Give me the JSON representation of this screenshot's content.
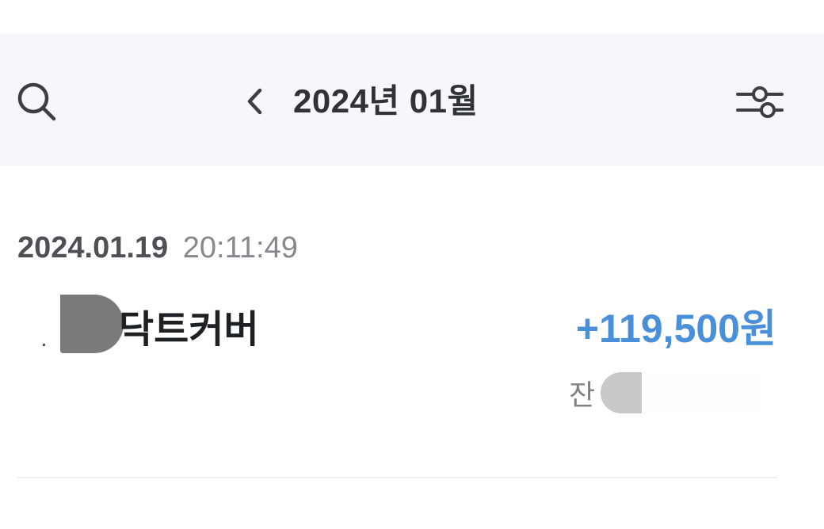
{
  "header": {
    "month_title": "2024년 01월",
    "search_icon": "search-icon",
    "prev_icon": "chevron-left-icon",
    "filter_icon": "filter-sliders-icon"
  },
  "transactions": [
    {
      "date": "2024.01.19",
      "time": "20:11:49",
      "name": "닥트커버",
      "amount": "+119,500원",
      "balance_label": "잔",
      "amount_color": "#4a8fd9"
    }
  ],
  "colors": {
    "header_bg": "#f5f7fb",
    "text_primary": "#1e2124",
    "text_secondary": "#85898e",
    "deposit": "#4a8fd9"
  }
}
